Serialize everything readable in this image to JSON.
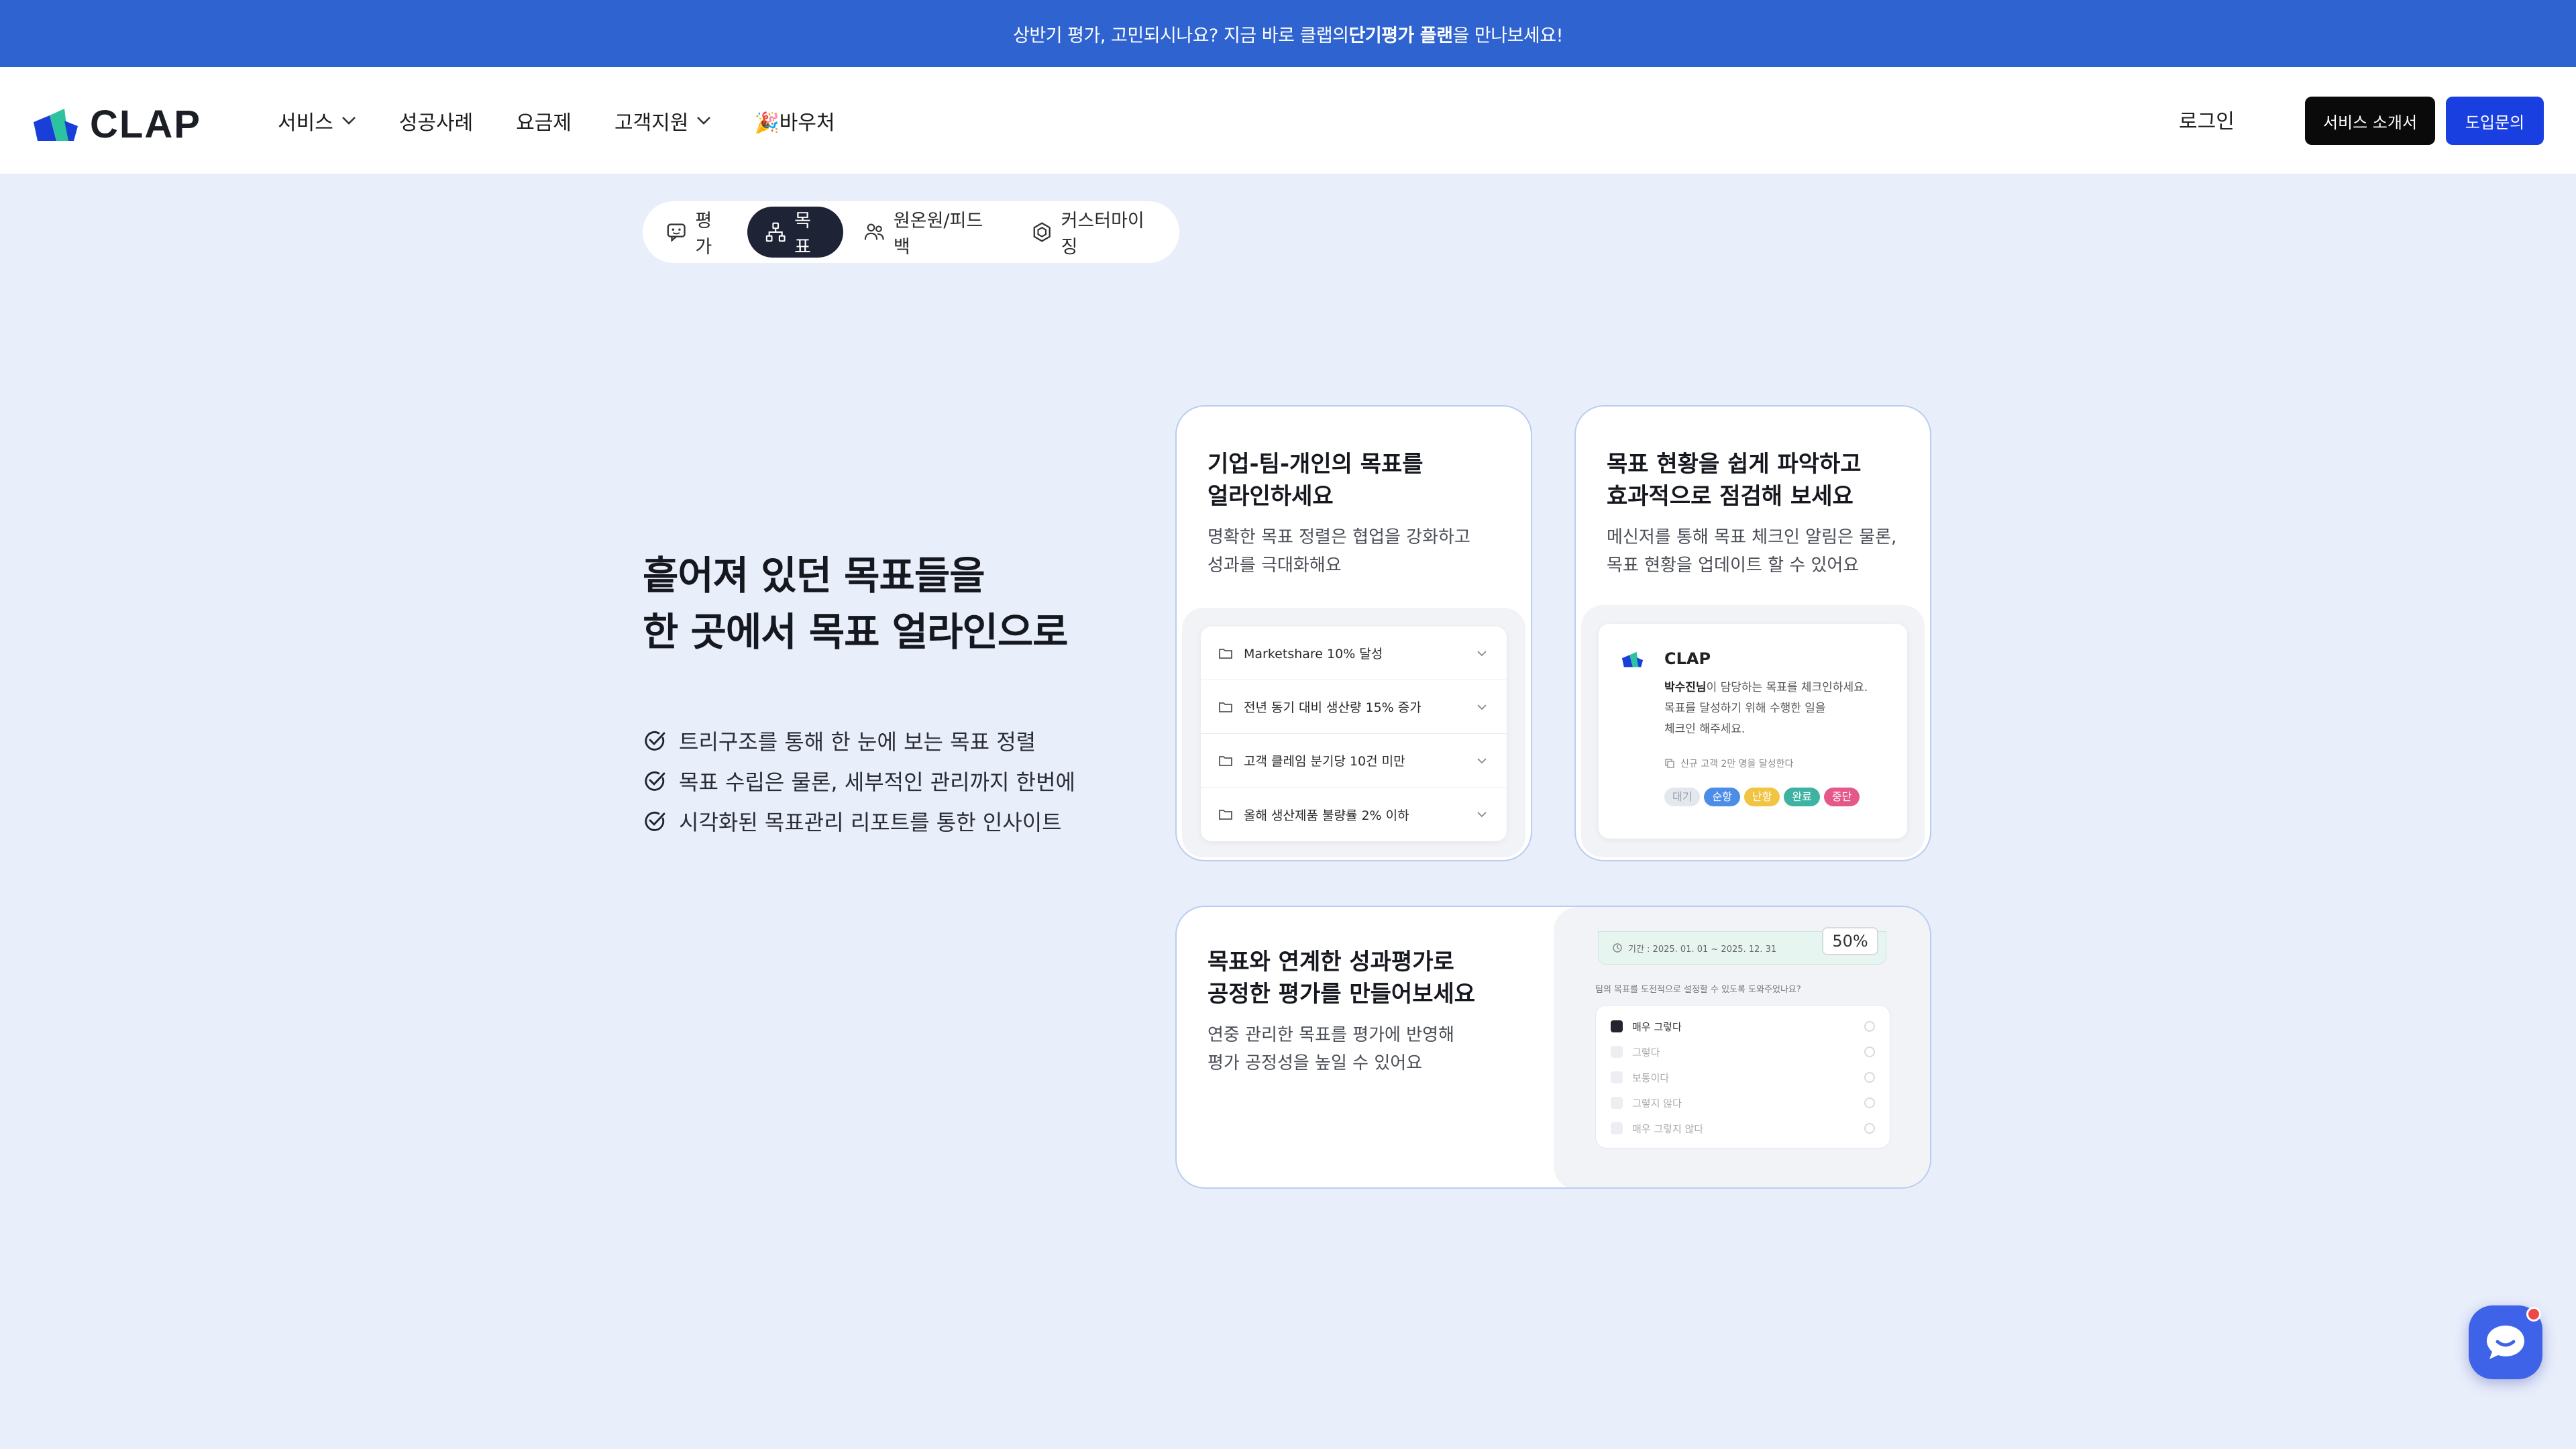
{
  "announcement": {
    "prefix": "상반기 평가, 고민되시나요? 지금 바로 클랩의 ",
    "bold": "단기평가 플랜",
    "suffix": "을 만나보세요!"
  },
  "header": {
    "logo_text": "CLAP",
    "nav": [
      {
        "label": "서비스",
        "has_dropdown": true
      },
      {
        "label": "성공사례",
        "has_dropdown": false
      },
      {
        "label": "요금제",
        "has_dropdown": false
      },
      {
        "label": "고객지원",
        "has_dropdown": true
      },
      {
        "label": "🎉바우처",
        "has_dropdown": false
      }
    ],
    "login_label": "로그인",
    "intro_button": "서비스 소개서",
    "contact_button": "도입문의"
  },
  "tabs": [
    {
      "label": "평가",
      "icon": "chat-icon",
      "active": false
    },
    {
      "label": "목표",
      "icon": "tree-icon",
      "active": true
    },
    {
      "label": "원온원/피드백",
      "icon": "people-icon",
      "active": false
    },
    {
      "label": "커스터마이징",
      "icon": "hexagon-icon",
      "active": false
    }
  ],
  "hero": {
    "title_line1": "흩어져 있던 목표들을",
    "title_line2": "한 곳에서 목표 얼라인으로",
    "bullets": [
      "트리구조를 통해 한 눈에 보는 목표 정렬",
      "목표 수립은 물론, 세부적인 관리까지 한번에",
      "시각화된 목표관리 리포트를 통한 인사이트"
    ]
  },
  "cards": {
    "align": {
      "title_line1": "기업-팀-개인의 목표를",
      "title_line2": "얼라인하세요",
      "desc_line1": "명확한 목표 정렬은 협업을 강화하고",
      "desc_line2": "성과를 극대화해요",
      "goals": [
        "Marketshare 10% 달성",
        "전년 동기 대비 생산량 15% 증가",
        "고객 클레임 분기당 10건 미만",
        "올해 생산제품 불량률 2% 이하"
      ]
    },
    "status": {
      "title_line1": "목표 현황을 쉽게 파악하고",
      "title_line2": "효과적으로 점검해 보세요",
      "desc_line1": "메신저를 통해 목표 체크인 알림은 물론,",
      "desc_line2": "목표 현황을 업데이트 할 수 있어요",
      "msg_brand": "CLAP",
      "msg_name": "박수진님",
      "msg_line1_rest": "이 담당하는 목표를 체크인하세요.",
      "msg_line2": "목표를 달성하기 위해 수행한 일을",
      "msg_line3": "체크인 해주세요.",
      "msg_goal": "신규 고객 2만 명을 달성한다",
      "chips": [
        {
          "label": "대기",
          "color": "#e4e7ee",
          "text": "#9aa0ab"
        },
        {
          "label": "순항",
          "color": "#4c8de8",
          "text": "#ffffff"
        },
        {
          "label": "난항",
          "color": "#f2c443",
          "text": "#ffffff"
        },
        {
          "label": "완료",
          "color": "#3fb3a3",
          "text": "#ffffff"
        },
        {
          "label": "중단",
          "color": "#e5588a",
          "text": "#ffffff"
        }
      ]
    },
    "evaluation": {
      "title_line1": "목표와 연계한 성과평가로",
      "title_line2": "공정한 평가를 만들어보세요",
      "desc_line1": "연중 관리한 목표를 평가에 반영해",
      "desc_line2": "평가 공정성을 높일 수 있어요",
      "period": "기간 : 2025. 01. 01 ~ 2025. 12. 31",
      "percent": "50%",
      "question": "팀의 목표를 도전적으로 설정할 수 있도록 도와주었나요?",
      "options": [
        {
          "label": "매우 그렇다",
          "checked": true
        },
        {
          "label": "그렇다",
          "checked": false
        },
        {
          "label": "보통이다",
          "checked": false
        },
        {
          "label": "그렇지 않다",
          "checked": false
        },
        {
          "label": "매우 그렇지 않다",
          "checked": false
        }
      ]
    }
  },
  "colors": {
    "announce_bg": "#2f63cf",
    "page_bg": "#e9eefb",
    "primary_blue": "#1a3fe0",
    "tab_active": "#1e2335"
  }
}
